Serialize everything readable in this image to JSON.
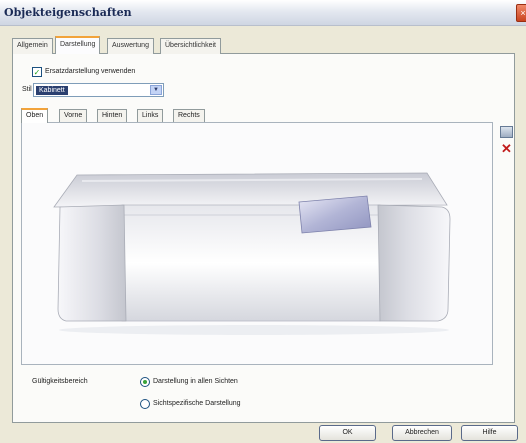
{
  "window": {
    "title": "Objekteigenschaften",
    "close_glyph": "×"
  },
  "tabs": [
    {
      "label": "Allgemein",
      "active": false
    },
    {
      "label": "Darstellung",
      "active": true
    },
    {
      "label": "Auswertung",
      "active": false
    },
    {
      "label": "Übersichtlichkeit",
      "active": false
    }
  ],
  "options": {
    "checkbox_label": "Ersatzdarstellung verwenden",
    "checkbox_checked": true,
    "checkbox_glyph": "✓",
    "style_label": "Stil",
    "style_value": "Kabinett",
    "select_arrow": "▼"
  },
  "view_tabs": [
    {
      "label": "Oben",
      "active": true
    },
    {
      "label": "Vorne",
      "active": false
    },
    {
      "label": "Hinten",
      "active": false
    },
    {
      "label": "Links",
      "active": false
    },
    {
      "label": "Rechts",
      "active": false
    }
  ],
  "side_tools": {
    "copy_icon": "copy-icon",
    "delete_icon": "delete-icon",
    "delete_glyph": "✕"
  },
  "scope": {
    "label": "Gültigkeitsbereich",
    "options": [
      {
        "label": "Darstellung in allen Sichten",
        "selected": true
      },
      {
        "label": "Sichtspezifische Darstellung",
        "selected": false
      }
    ]
  },
  "buttons": {
    "ok": "OK",
    "cancel": "Abbrechen",
    "help": "Hilfe"
  },
  "colors": {
    "selection_bg": "#2a3f6f",
    "active_tab_accent": "#f2a33a",
    "cushion_accent": "#9fa3c8"
  }
}
